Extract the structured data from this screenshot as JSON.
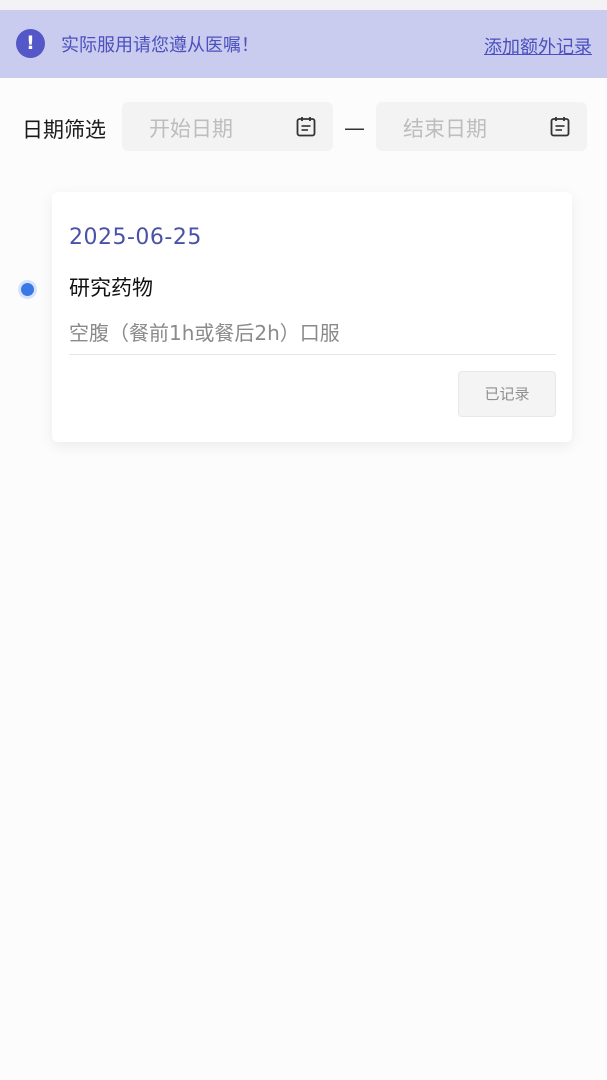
{
  "notice": {
    "icon": "exclamation-circle-icon",
    "icon_glyph": "!",
    "text": "实际服用请您遵从医嘱！",
    "action_label": "添加额外记录"
  },
  "filter": {
    "label": "日期筛选",
    "start_placeholder": "开始日期",
    "separator": "—",
    "end_placeholder": "结束日期",
    "calendar_icon": "calendar-icon"
  },
  "records": [
    {
      "date": "2025-06-25",
      "drug_name": "研究药物",
      "instruction": "空腹（餐前1h或餐后2h）口服",
      "status_label": "已记录"
    }
  ],
  "colors": {
    "notice_bg": "#c9cbef",
    "accent": "#4b50be",
    "timeline_dot": "#3a78e6"
  }
}
